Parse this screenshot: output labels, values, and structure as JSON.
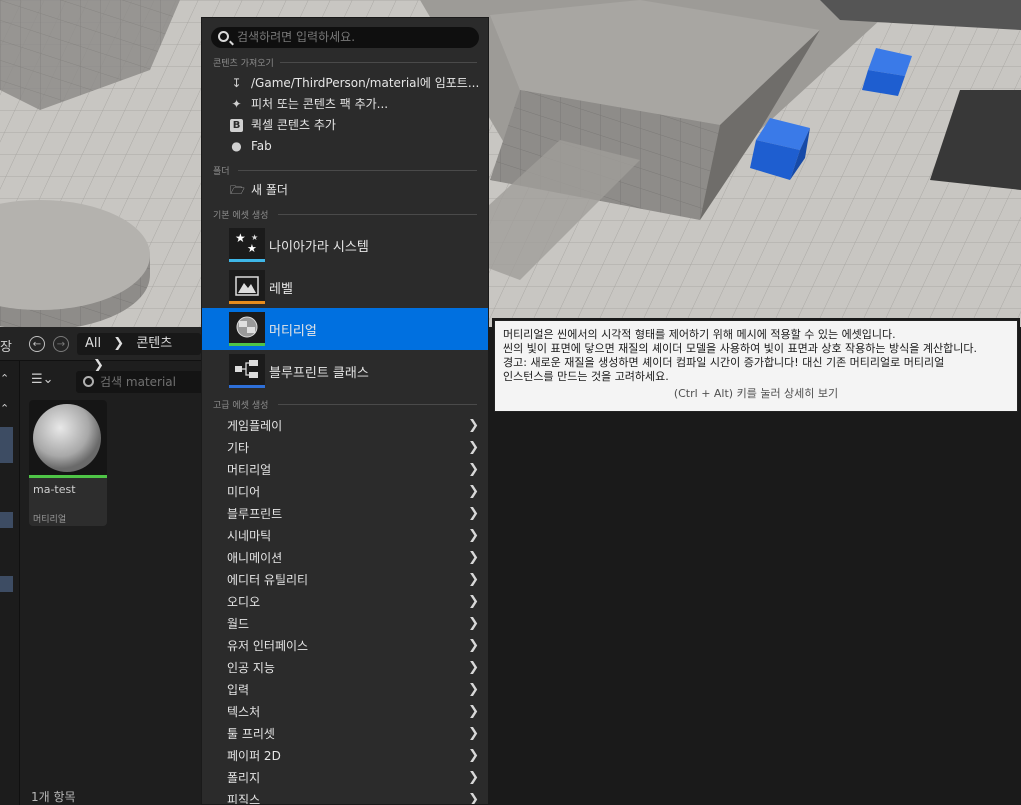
{
  "menu": {
    "search_placeholder": "검색하려면 입력하세요.",
    "sections": {
      "import": "콘텐츠 가져오기",
      "folder": "폴더",
      "basic": "기본 에셋 생성",
      "advanced": "고급 에셋 생성"
    },
    "import_items": [
      {
        "label": "/Game/ThirdPerson/material에 임포트...",
        "icon": "import-icon"
      },
      {
        "label": "피처 또는 콘텐츠 팩 추가...",
        "icon": "feature-pack-icon"
      },
      {
        "label": "퀵셀 콘텐츠 추가",
        "icon": "quixel-icon"
      },
      {
        "label": "Fab",
        "icon": "fab-icon"
      }
    ],
    "folder_items": [
      {
        "label": "새 폴더",
        "icon": "new-folder-icon"
      }
    ],
    "basic_items": [
      {
        "label": "나이아가라 시스템",
        "icon": "niagara-icon",
        "color": "#3fb7e8"
      },
      {
        "label": "레벨",
        "icon": "level-icon",
        "color": "#e88c1c"
      },
      {
        "label": "머티리얼",
        "icon": "material-icon",
        "color": "#4fc547",
        "selected": true
      },
      {
        "label": "블루프린트 클래스",
        "icon": "blueprint-icon",
        "color": "#2e6fd8"
      }
    ],
    "advanced_items": [
      "게임플레이",
      "기타",
      "머티리얼",
      "미디어",
      "블루프린트",
      "시네마틱",
      "애니메이션",
      "에디터 유틸리티",
      "오디오",
      "월드",
      "유저 인터페이스",
      "인공 지능",
      "입력",
      "텍스처",
      "툴 프리셋",
      "페이퍼 2D",
      "폴리지",
      "피직스"
    ]
  },
  "tooltip": {
    "line1": "머티리얼은 씬에서의 시각적 형태를 제어하기 위해 메시에 적용할 수 있는 에셋입니다.",
    "line2": "씬의 빛이 표면에 닿으면 재질의 셰이더 모델을 사용하여 빛이 표면과 상호 작용하는 방식을 계산합니다.",
    "line3": "경고: 새로운 재질을 생성하면 셰이더 컴파일 시간이 증가합니다! 대신 기존 머티리얼로 머티리얼",
    "line4": "인스턴스를 만드는 것을 고려하세요.",
    "hint": "(Ctrl + Alt) 키를 눌러 상세히 보기"
  },
  "content_browser": {
    "left_label": "장",
    "breadcrumb": [
      "All",
      "콘텐츠"
    ],
    "search_placeholder": "검색 material",
    "asset": {
      "name": "ma-test",
      "type": "머티리얼"
    },
    "item_count": "1개 항목"
  },
  "colors": {
    "accent": "#0070e0",
    "menu_bg": "#2b2b2b",
    "material_bar": "#4fc547"
  }
}
